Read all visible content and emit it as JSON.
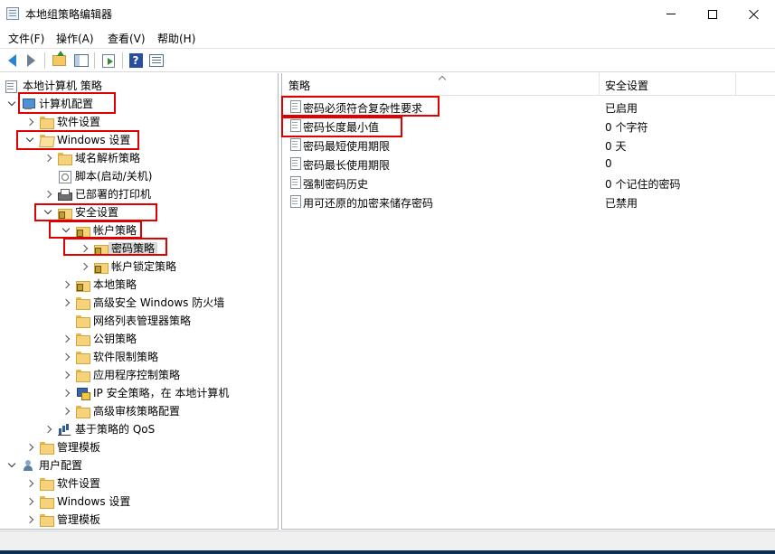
{
  "window": {
    "title": "本地组策略编辑器",
    "icon": "policy-editor-icon"
  },
  "menu": [
    {
      "label": "文件(F)"
    },
    {
      "label": "操作(A)"
    },
    {
      "label": "查看(V)"
    },
    {
      "label": "帮助(H)"
    }
  ],
  "toolbar": {
    "icons": [
      "back-icon",
      "forward-icon",
      "up-folder-icon",
      "show-hide-tree-icon",
      "export-list-icon",
      "help-icon",
      "properties-icon"
    ],
    "help_glyph": "?"
  },
  "tree": {
    "root": "本地计算机 策略",
    "items": [
      {
        "label": "计算机配置",
        "level": 0,
        "expanded": true,
        "icon": "computer-icon"
      },
      {
        "label": "软件设置",
        "level": 1,
        "expanded": false,
        "icon": "folder-icon"
      },
      {
        "label": "Windows 设置",
        "level": 1,
        "expanded": true,
        "icon": "folder-icon"
      },
      {
        "label": "域名解析策略",
        "level": 2,
        "expanded": false,
        "icon": "folder-icon"
      },
      {
        "label": "脚本(启动/关机)",
        "level": 2,
        "icon": "script-icon"
      },
      {
        "label": "已部署的打印机",
        "level": 2,
        "expanded": false,
        "icon": "printer-icon"
      },
      {
        "label": "安全设置",
        "level": 2,
        "expanded": true,
        "icon": "lock-folder-icon"
      },
      {
        "label": "帐户策略",
        "level": 3,
        "expanded": true,
        "icon": "lock-folder-icon"
      },
      {
        "label": "密码策略",
        "level": 4,
        "expanded": false,
        "icon": "lock-folder-icon",
        "selected": true
      },
      {
        "label": "帐户锁定策略",
        "level": 4,
        "expanded": false,
        "icon": "lock-folder-icon"
      },
      {
        "label": "本地策略",
        "level": 3,
        "expanded": false,
        "icon": "lock-folder-icon"
      },
      {
        "label": "高级安全 Windows 防火墙",
        "level": 3,
        "expanded": false,
        "icon": "folder-icon"
      },
      {
        "label": "网络列表管理器策略",
        "level": 3,
        "icon": "folder-icon"
      },
      {
        "label": "公钥策略",
        "level": 3,
        "expanded": false,
        "icon": "folder-icon"
      },
      {
        "label": "软件限制策略",
        "level": 3,
        "expanded": false,
        "icon": "folder-icon"
      },
      {
        "label": "应用程序控制策略",
        "level": 3,
        "expanded": false,
        "icon": "folder-icon"
      },
      {
        "label": "IP 安全策略，在 本地计算机",
        "level": 3,
        "expanded": false,
        "icon": "ipsec-icon"
      },
      {
        "label": "高级审核策略配置",
        "level": 3,
        "expanded": false,
        "icon": "folder-icon"
      },
      {
        "label": "基于策略的 QoS",
        "level": 2,
        "expanded": false,
        "icon": "qos-icon"
      },
      {
        "label": "管理模板",
        "level": 1,
        "expanded": false,
        "icon": "folder-icon"
      },
      {
        "label": "用户配置",
        "level": 0,
        "expanded": true,
        "icon": "user-icon"
      },
      {
        "label": "软件设置",
        "level": 1,
        "expanded": false,
        "icon": "folder-icon"
      },
      {
        "label": "Windows 设置",
        "level": 1,
        "expanded": false,
        "icon": "folder-icon"
      },
      {
        "label": "管理模板",
        "level": 1,
        "expanded": false,
        "icon": "folder-icon"
      }
    ]
  },
  "list": {
    "columns": [
      "策略",
      "安全设置"
    ],
    "rows": [
      {
        "policy": "密码必须符合复杂性要求",
        "value": "已启用"
      },
      {
        "policy": "密码长度最小值",
        "value": "0 个字符"
      },
      {
        "policy": "密码最短使用期限",
        "value": "0 天"
      },
      {
        "policy": "密码最长使用期限",
        "value": "0"
      },
      {
        "policy": "强制密码历史",
        "value": "0 个记住的密码"
      },
      {
        "policy": "用可还原的加密来储存密码",
        "value": "已禁用"
      }
    ]
  },
  "colors": {
    "annotation": "#e00000",
    "accent": "#2a84d2",
    "taskbar": "#0b2e55"
  }
}
